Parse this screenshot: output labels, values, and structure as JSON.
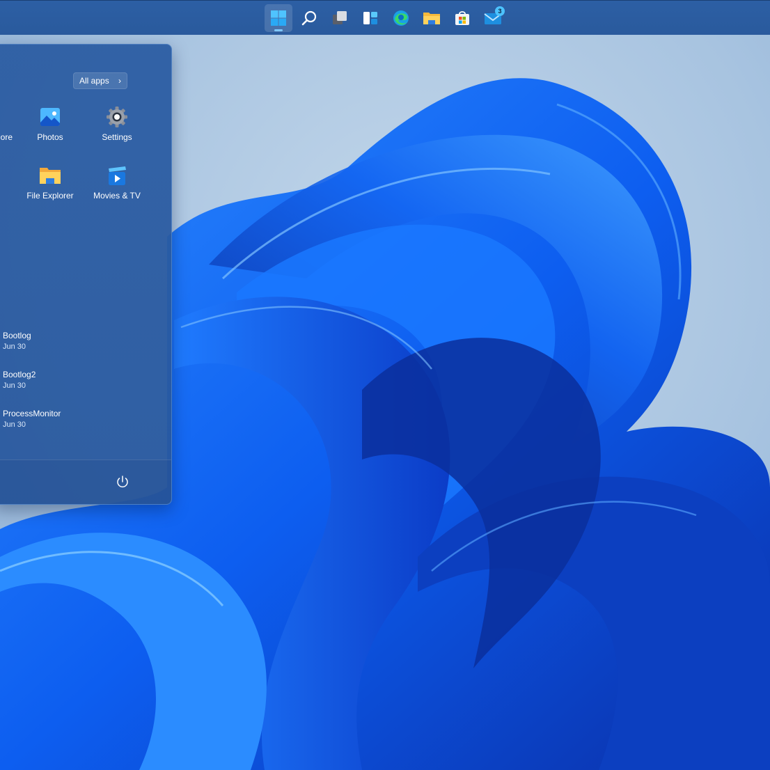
{
  "taskbar": {
    "items": [
      {
        "name": "Start",
        "icon": "windows-logo-icon",
        "active": true
      },
      {
        "name": "Search",
        "icon": "search-icon"
      },
      {
        "name": "Task View",
        "icon": "task-view-icon"
      },
      {
        "name": "Widgets",
        "icon": "widgets-icon"
      },
      {
        "name": "Microsoft Edge",
        "icon": "edge-icon"
      },
      {
        "name": "File Explorer",
        "icon": "folder-icon"
      },
      {
        "name": "Microsoft Store",
        "icon": "store-icon"
      },
      {
        "name": "Mail",
        "icon": "mail-icon",
        "badge": "3"
      }
    ]
  },
  "start_menu": {
    "all_apps_label": "All apps",
    "all_apps_chevron": "›",
    "partial_pinned_label": "ore",
    "pinned": [
      {
        "label": "Photos",
        "icon": "photos-icon"
      },
      {
        "label": "Settings",
        "icon": "gear-icon"
      },
      {
        "label": "File Explorer",
        "icon": "folder-icon"
      },
      {
        "label": "Movies & TV",
        "icon": "movies-tv-icon"
      }
    ],
    "recommended": [
      {
        "name": "Bootlog",
        "date": "Jun 30"
      },
      {
        "name": "Bootlog2",
        "date": "Jun 30"
      },
      {
        "name": "ProcessMonitor",
        "date": "Jun 30"
      }
    ],
    "power_icon": "power-icon"
  },
  "colors": {
    "taskbar": "#2c5fa4",
    "start_menu": "#2b5ca2",
    "accent": "#4cc2ff",
    "wallpaper_sky": "#a9c6e2",
    "wallpaper_bloom": "#1565f0"
  }
}
